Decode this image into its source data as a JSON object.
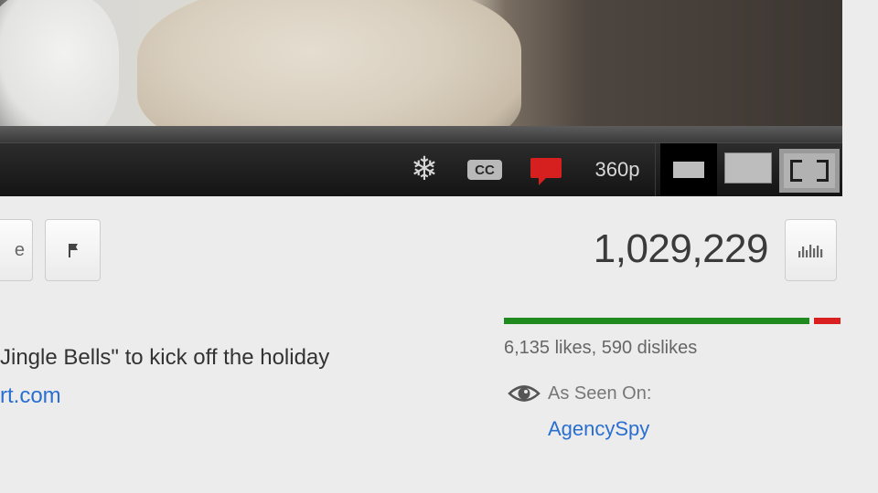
{
  "player": {
    "controls": {
      "annotations_icon": "snowflake-icon",
      "cc_label": "CC",
      "comment_icon": "speech-bubble-icon",
      "quality": "360p",
      "size_small_icon": "small-player-icon",
      "size_large_icon": "large-player-icon",
      "fullscreen_icon": "fullscreen-icon"
    }
  },
  "actions": {
    "share_label_visible": "e",
    "flag_icon": "flag-icon"
  },
  "stats": {
    "view_count": "1,029,229",
    "stats_icon": "bar-chart-icon",
    "likes": 6135,
    "dislikes": 590,
    "likes_text": "6,135 likes, 590 dislikes",
    "like_color": "#1f8b1f",
    "dislike_color": "#d91f1f"
  },
  "seen_on": {
    "icon": "eye-icon",
    "label": "As Seen On:",
    "link": "AgencySpy"
  },
  "description": {
    "line1": "Jingle Bells\" to kick off the holiday",
    "line2_link": "rt.com"
  }
}
